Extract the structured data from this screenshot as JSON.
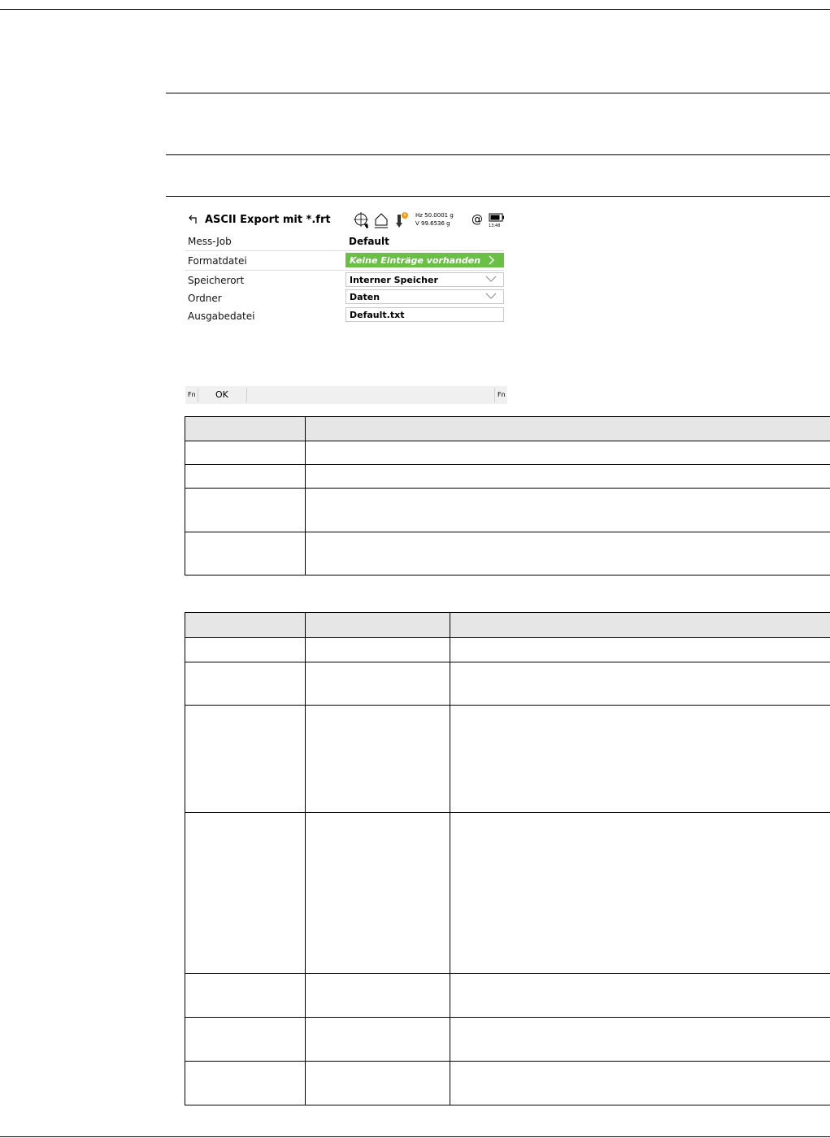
{
  "screen": {
    "title": "ASCII Export mit *.frt",
    "status": {
      "hz": "Hz 50.0001 g",
      "v": "V   99.6536 g",
      "time": "13:48",
      "at_symbol": "@"
    },
    "fields": [
      {
        "label": "Mess-Job",
        "value": "Default"
      },
      {
        "label": "Formatdatei",
        "value": "Keine Einträge vorhanden"
      },
      {
        "label": "Speicherort",
        "value": "Interner Speicher"
      },
      {
        "label": "Ordner",
        "value": "Daten"
      },
      {
        "label": "Ausgabedatei",
        "value": "Default.txt"
      }
    ],
    "softkeys": {
      "fn_left": "Fn",
      "ok": "OK",
      "fn_right": "Fn"
    }
  },
  "colors": {
    "accent_green": "#6abf45",
    "table_header_bg": "#e6e6e6"
  }
}
